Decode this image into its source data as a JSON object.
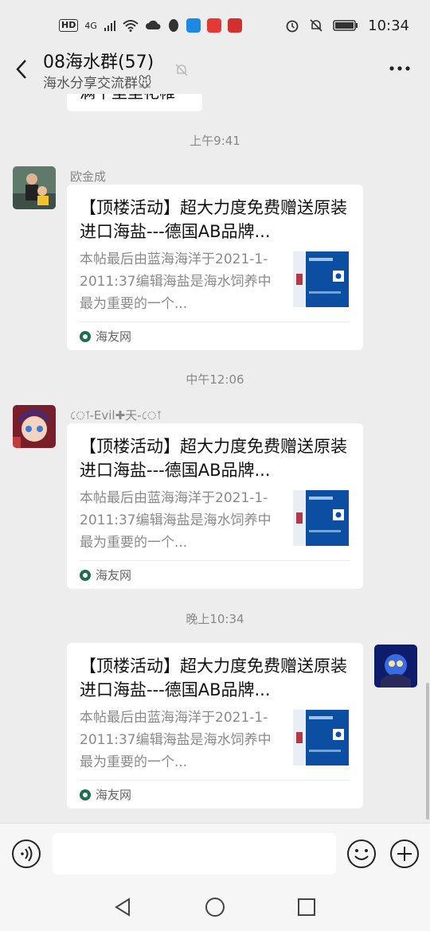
{
  "status_bar": {
    "hd": "HD",
    "network": "4G",
    "time": "10:34"
  },
  "header": {
    "title": "08海水群(57)",
    "subtitle": "海水分享交流群🐭"
  },
  "previous_message": {
    "text": "满千里里花帷"
  },
  "messages": [
    {
      "timestamp": "上午9:41",
      "sender": "欧金成",
      "side": "left",
      "card": {
        "title": "【顶楼活动】超大力度免费赠送原装进口海盐---德国AB品牌...",
        "description": "本帖最后由蓝海海洋于2021-1-2011:37编辑海盐是海水饲养中最为重要的一个...",
        "source": "海友网"
      }
    },
    {
      "timestamp": "中午12:06",
      "sender": "ো-Evil✚天-ো",
      "side": "left",
      "card": {
        "title": "【顶楼活动】超大力度免费赠送原装进口海盐---德国AB品牌...",
        "description": "本帖最后由蓝海海洋于2021-1-2011:37编辑海盐是海水饲养中最为重要的一个...",
        "source": "海友网"
      }
    },
    {
      "timestamp": "晚上10:34",
      "sender": "",
      "side": "right",
      "card": {
        "title": "【顶楼活动】超大力度免费赠送原装进口海盐---德国AB品牌...",
        "description": "本帖最后由蓝海海洋于2021-1-2011:37编辑海盐是海水饲养中最为重要的一个...",
        "source": "海友网"
      }
    }
  ],
  "colors": {
    "background": "#ededed",
    "bubble": "#ffffff",
    "muted_text": "#888888"
  }
}
